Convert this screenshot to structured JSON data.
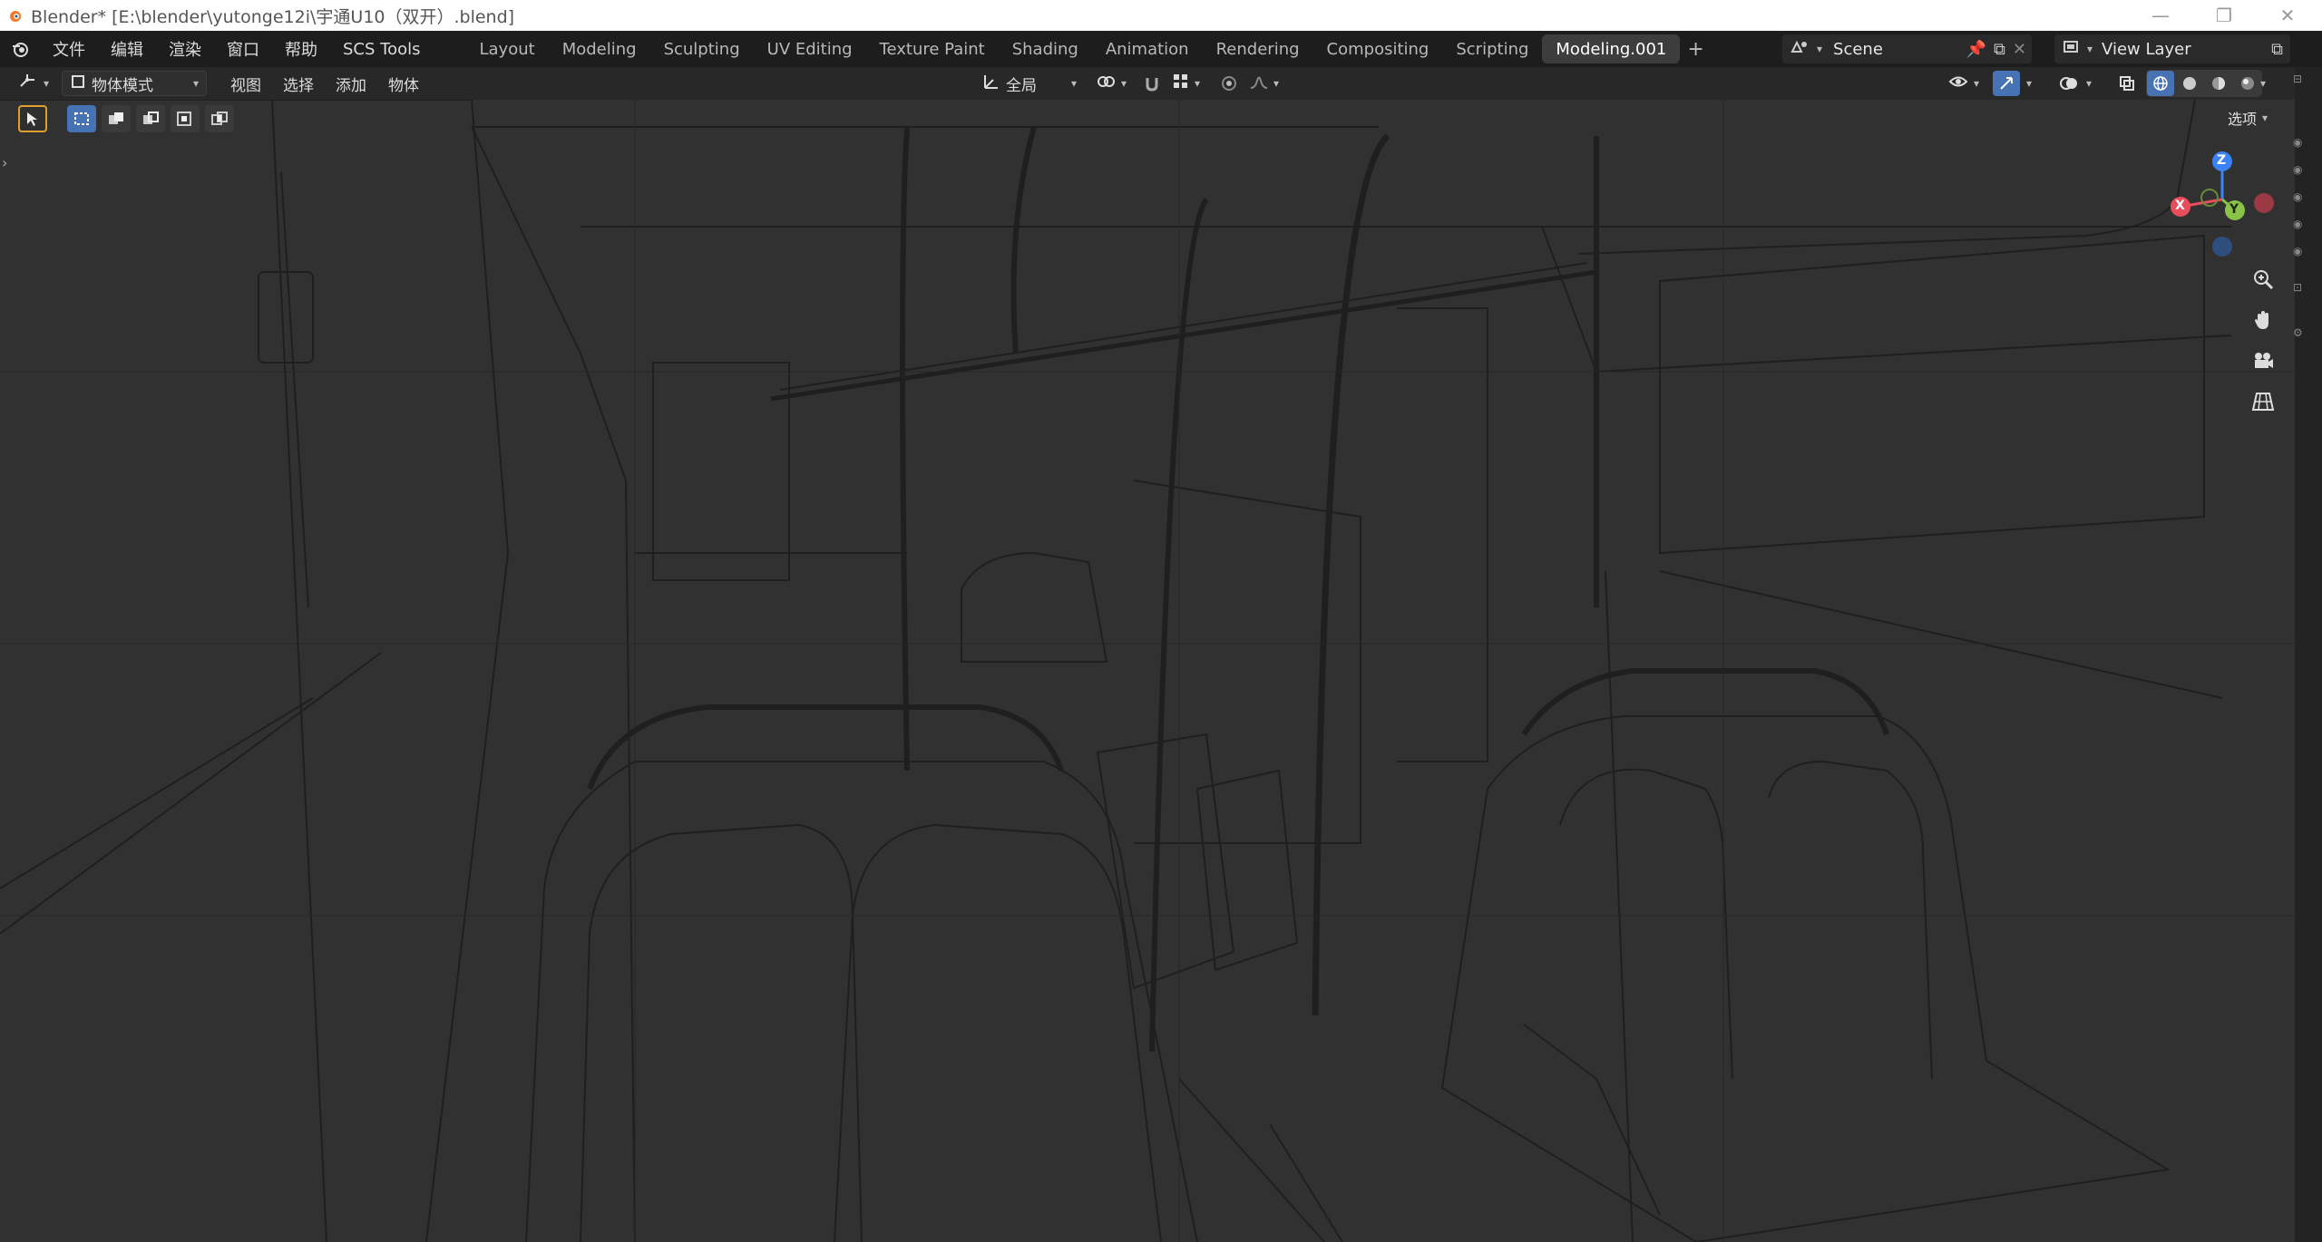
{
  "window": {
    "title": "Blender* [E:\\blender\\yutonge12i\\宇通U10（双开）.blend]"
  },
  "menu": {
    "items": [
      "文件",
      "编辑",
      "渲染",
      "窗口",
      "帮助",
      "SCS Tools"
    ]
  },
  "workspaces": {
    "tabs": [
      "Layout",
      "Modeling",
      "Sculpting",
      "UV Editing",
      "Texture Paint",
      "Shading",
      "Animation",
      "Rendering",
      "Compositing",
      "Scripting",
      "Modeling.001"
    ],
    "active": "Modeling.001",
    "add_label": "+"
  },
  "scene": {
    "label": "Scene"
  },
  "view_layer": {
    "label": "View Layer"
  },
  "viewport_header": {
    "mode": "物体模式",
    "menus": [
      "视图",
      "选择",
      "添加",
      "物体"
    ],
    "transform_orientation": "全局",
    "options_label": "选项"
  },
  "gizmo": {
    "z": "Z",
    "y": "Y",
    "x": "X"
  },
  "colors": {
    "accent": "#4772b3",
    "axis_x": "#e84d5b",
    "axis_y": "#8bc34a",
    "axis_z": "#3b82f6"
  }
}
